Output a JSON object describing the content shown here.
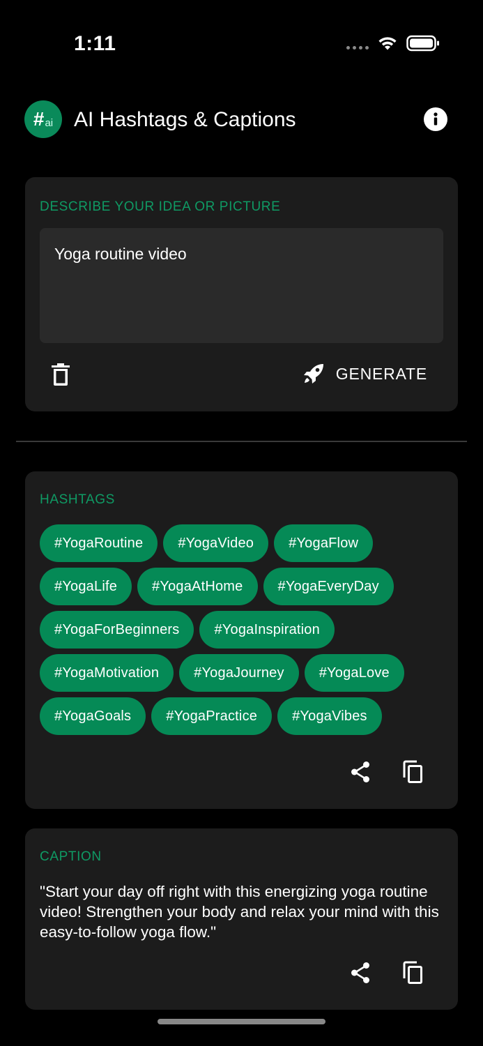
{
  "status_bar": {
    "time": "1:11",
    "icons": [
      "signal-dots-icon",
      "wifi-icon",
      "battery-icon"
    ]
  },
  "header": {
    "logo_hash": "#",
    "logo_ai": "ai",
    "title": "AI Hashtags & Captions",
    "info_icon": "info-icon"
  },
  "idea": {
    "label": "DESCRIBE YOUR IDEA OR PICTURE",
    "input_value": "Yoga routine video",
    "clear_icon": "trash-icon",
    "generate_icon": "rocket-icon",
    "generate_label": "GENERATE"
  },
  "hashtags": {
    "label": "HASHTAGS",
    "tags": [
      "#YogaRoutine",
      "#YogaVideo",
      "#YogaFlow",
      "#YogaLife",
      "#YogaAtHome",
      "#YogaEveryDay",
      "#YogaForBeginners",
      "#YogaInspiration",
      "#YogaMotivation",
      "#YogaJourney",
      "#YogaLove",
      "#YogaGoals",
      "#YogaPractice",
      "#YogaVibes"
    ],
    "share_icon": "share-icon",
    "copy_icon": "copy-icon"
  },
  "caption": {
    "label": "CAPTION",
    "text": "\"Start your day off right with this energizing yoga routine video! Strengthen your body and relax your mind with this easy-to-follow yoga flow.\"",
    "share_icon": "share-icon",
    "copy_icon": "copy-icon"
  },
  "colors": {
    "accent": "#0f9a64",
    "chip": "#058a56",
    "card": "#1c1c1c",
    "input": "#2a2a2a",
    "background": "#000000"
  }
}
